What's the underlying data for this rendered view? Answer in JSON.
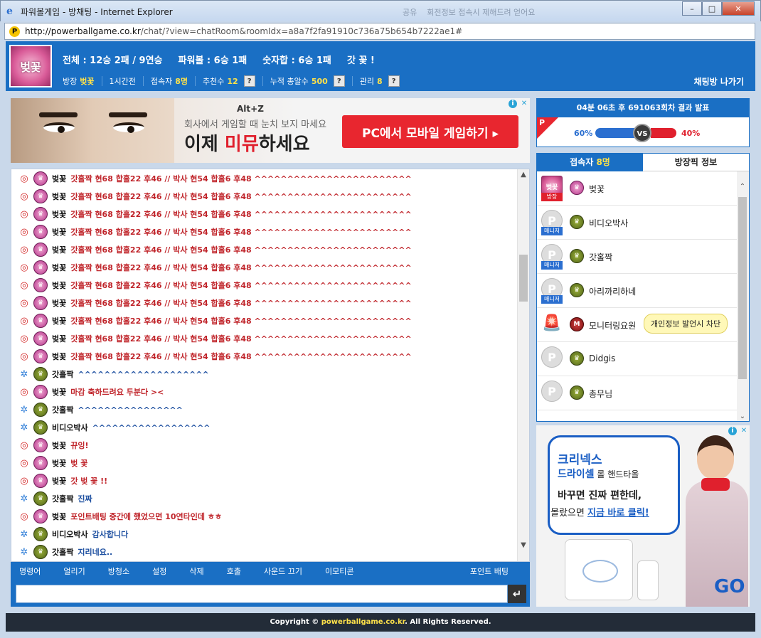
{
  "window": {
    "title": "파워볼게임 - 방채팅 - Internet Explorer",
    "background_tab": "공유",
    "background_tab2": "회전정보 접속시 제해드려 얻어요",
    "url_host": "http://powerballgame.co.kr",
    "url_path": "/chat/?view=chatRoom&roomIdx=a8a7f2fa91910c736a75b654b7222ae1#"
  },
  "header": {
    "avatar_text": "벚꽃",
    "stats": {
      "total": "전체 : 12승 2패 / 9연승",
      "powerball": "파워볼 : 6승 1패",
      "numsum": "숫자합 : 6승 1패",
      "tag": "갓 꽃 !"
    },
    "sub": {
      "host_label": "방장",
      "host_name": "벚꽃",
      "duration": "1시간전",
      "users_label": "접속자",
      "users_value": "8명",
      "recommend_label": "추천수",
      "recommend_value": "12",
      "bet_label": "누적 총알수",
      "bet_value": "500",
      "manage_label": "관리",
      "manage_value": "8",
      "q": "?"
    },
    "leave": "채팅방 나가기"
  },
  "ad_top": {
    "hotkey": "Alt+Z",
    "line1": "회사에서 게임할 때 눈치 보지 마세요",
    "line2_a": "이제 ",
    "line2_b": "미뮤",
    "line2_c": "하세요",
    "button": "PC에서 모바일 게임하기 ▸",
    "info": "i",
    "close": "✕"
  },
  "messages": [
    {
      "nick": "벚꽃",
      "text": "갓홀짝 현68 합홀22 후46 // 박사 현54 합홀6 후48 ^^^^^^^^^^^^^^^^^^^^^^^^",
      "kind": "red"
    },
    {
      "nick": "벚꽃",
      "text": "갓홀짝 현68 합홀22 후46 // 박사 현54 합홀6 후48 ^^^^^^^^^^^^^^^^^^^^^^^^",
      "kind": "red"
    },
    {
      "nick": "벚꽃",
      "text": "갓홀짝 현68 합홀22 후46 // 박사 현54 합홀6 후48 ^^^^^^^^^^^^^^^^^^^^^^^^",
      "kind": "red"
    },
    {
      "nick": "벚꽃",
      "text": "갓홀짝 현68 합홀22 후46 // 박사 현54 합홀6 후48 ^^^^^^^^^^^^^^^^^^^^^^^^",
      "kind": "red"
    },
    {
      "nick": "벚꽃",
      "text": "갓홀짝 현68 합홀22 후46 // 박사 현54 합홀6 후48 ^^^^^^^^^^^^^^^^^^^^^^^^",
      "kind": "red"
    },
    {
      "nick": "벚꽃",
      "text": "갓홀짝 현68 합홀22 후46 // 박사 현54 합홀6 후48 ^^^^^^^^^^^^^^^^^^^^^^^^",
      "kind": "red"
    },
    {
      "nick": "벚꽃",
      "text": "갓홀짝 현68 합홀22 후46 // 박사 현54 합홀6 후48 ^^^^^^^^^^^^^^^^^^^^^^^^",
      "kind": "red"
    },
    {
      "nick": "벚꽃",
      "text": "갓홀짝 현68 합홀22 후46 // 박사 현54 합홀6 후48 ^^^^^^^^^^^^^^^^^^^^^^^^",
      "kind": "red"
    },
    {
      "nick": "벚꽃",
      "text": "갓홀짝 현68 합홀22 후46 // 박사 현54 합홀6 후48 ^^^^^^^^^^^^^^^^^^^^^^^^",
      "kind": "red"
    },
    {
      "nick": "벚꽃",
      "text": "갓홀짝 현68 합홀22 후46 // 박사 현54 합홀6 후48 ^^^^^^^^^^^^^^^^^^^^^^^^",
      "kind": "red"
    },
    {
      "nick": "벚꽃",
      "text": "갓홀짝 현68 합홀22 후46 // 박사 현54 합홀6 후48 ^^^^^^^^^^^^^^^^^^^^^^^^",
      "kind": "red"
    },
    {
      "nick": "갓홀짝",
      "text": "^^^^^^^^^^^^^^^^^^^^",
      "kind": "blue"
    },
    {
      "nick": "벚꽃",
      "text": "마감 축하드려요 두분다 ><",
      "kind": "red"
    },
    {
      "nick": "갓홀짝",
      "text": "^^^^^^^^^^^^^^^^",
      "kind": "blue"
    },
    {
      "nick": "비디오박사",
      "text": "^^^^^^^^^^^^^^^^^^",
      "kind": "blue"
    },
    {
      "nick": "벚꽃",
      "text": "뀨잉!",
      "kind": "red"
    },
    {
      "nick": "벚꽃",
      "text": "벚 꽃",
      "kind": "red"
    },
    {
      "nick": "벚꽃",
      "text": "갓 벚 꽃 !!",
      "kind": "red"
    },
    {
      "nick": "갓홀짝",
      "text": "진짜",
      "kind": "blue"
    },
    {
      "nick": "벚꽃",
      "text": "포인트배팅 중간에 했었으면 10연타인데 ㅎㅎ",
      "kind": "red"
    },
    {
      "nick": "비디오박사",
      "text": "감사합니다",
      "kind": "blue"
    },
    {
      "nick": "갓홀짝",
      "text": "지리네요..",
      "kind": "blue"
    }
  ],
  "toolbar": {
    "items": [
      "명령어",
      "얼리기",
      "방청소",
      "설정",
      "삭제",
      "호출",
      "사운드 끄기",
      "이모티콘"
    ],
    "point_bet": "포인트 배팅"
  },
  "input": {
    "placeholder": "",
    "send": "↵"
  },
  "result": {
    "header": "04분 06초 후 691063회차 결과 발표",
    "p_mark": "P",
    "left_pct": "60%",
    "right_pct": "40%",
    "left_share": 60,
    "right_share": 40,
    "vs": "VS"
  },
  "users_panel": {
    "tab_users_label": "접속자",
    "tab_users_count": "8명",
    "tab_host_info": "방장픽 정보",
    "users": [
      {
        "name": "벚꽃",
        "role": "방장",
        "pic": "host",
        "ava": "pink"
      },
      {
        "name": "비디오박사",
        "role": "매니저",
        "pic": "p",
        "ava": "green"
      },
      {
        "name": "갓홀짝",
        "role": "매니저",
        "pic": "p",
        "ava": "green"
      },
      {
        "name": "아리까리하네",
        "role": "매니저",
        "pic": "p",
        "ava": "green"
      },
      {
        "name": "모니터링요원",
        "role": "",
        "pic": "alarm",
        "ava": "red"
      },
      {
        "name": "Didgis",
        "role": "",
        "pic": "p",
        "ava": "green"
      },
      {
        "name": "총무님",
        "role": "",
        "pic": "p",
        "ava": "green"
      }
    ],
    "tooltip": "개인정보 발언시 차단"
  },
  "ad_side": {
    "brand": "크리넥스",
    "sub_a": "드라이셀",
    "sub_b": " 롤 핸드타올",
    "line1": "바꾸면 진짜 편한데,",
    "line2_a": "몰랐으면 ",
    "line2_b": "지금 바로 클릭!",
    "go": "GO",
    "info": "i",
    "close": "✕"
  },
  "footer": {
    "a": "Copyright ©",
    "b": "powerballgame.co.kr",
    "c": ". All Rights Reserved."
  }
}
